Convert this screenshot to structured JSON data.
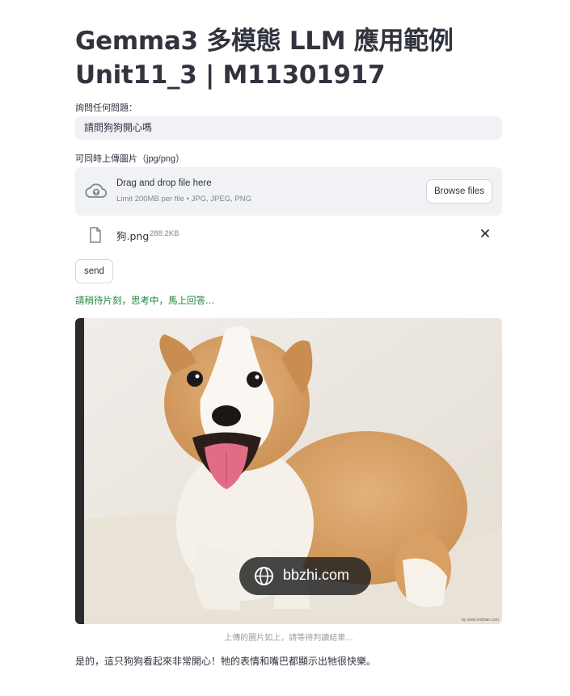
{
  "header": {
    "title_line1": "Gemma3 多模態 LLM 應用範例",
    "title_line2": "Unit11_3 | M11301917"
  },
  "question": {
    "label": "詢問任何問題：",
    "value": "請問狗狗開心嗎"
  },
  "uploader": {
    "label": "可同時上傳圖片（jpg/png）",
    "drop_text": "Drag and drop file here",
    "limit_text": "Limit 200MB per file • JPG, JPEG, PNG",
    "browse_label": "Browse files",
    "file": {
      "name": "狗.png",
      "size": "288.2KB"
    }
  },
  "send_label": "send",
  "status_text": "請稍待片刻，思考中，馬上回答...",
  "image": {
    "watermark": "bbzhi.com",
    "credit": "by www.mdhian.com",
    "caption": "上傳的圖片如上，請等待判讀結果..."
  },
  "answer_text": "是的，這只狗狗看起來非常開心！牠的表情和嘴巴都顯示出牠很快樂。",
  "colors": {
    "status_green": "#21863c",
    "input_bg": "#f0f2f6",
    "text": "#31333f"
  },
  "icons": {
    "upload": "cloud-upload-icon",
    "file": "file-icon",
    "close": "close-icon",
    "watermark": "globe-icon"
  }
}
